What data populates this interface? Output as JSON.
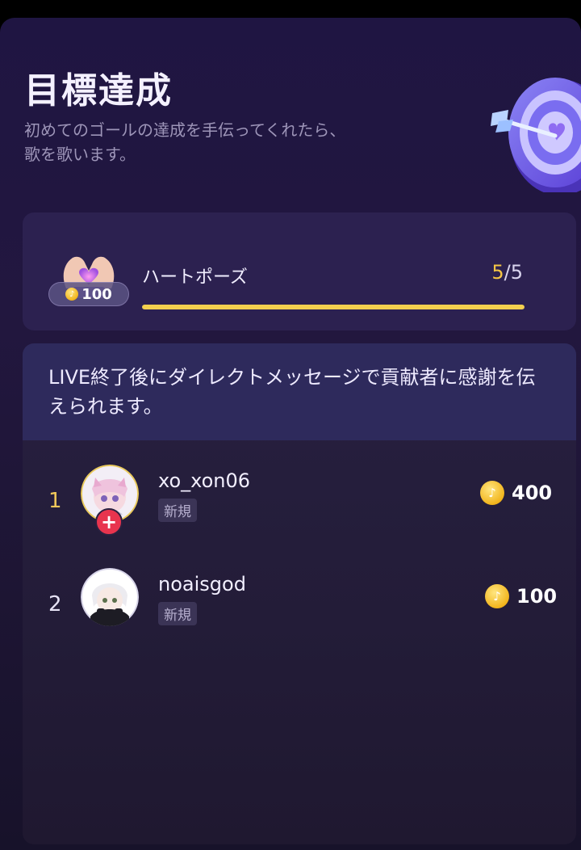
{
  "panel": {
    "title": "目標達成",
    "subtitle": "初めてのゴールの達成を手伝ってくれたら、歌を歌います。"
  },
  "goal": {
    "gift_name": "ハートポーズ",
    "gift_price": "100",
    "current": "5",
    "separator": "/",
    "target": "5",
    "progress_fraction": 1.0
  },
  "contributors": {
    "note": "LIVE終了後にダイレクトメッセージで貢献者に感謝を伝えられます。",
    "rows": [
      {
        "rank": "1",
        "username": "xo_xon06",
        "tag": "新規",
        "coins": "400"
      },
      {
        "rank": "2",
        "username": "noaisgod",
        "tag": "新規",
        "coins": "100"
      }
    ]
  },
  "colors": {
    "accent_gold": "#f5c544",
    "progress_fill": "#f4d04e",
    "follow_badge": "#e8344e"
  },
  "icons": {
    "coin": "tiktok-coin-icon",
    "follow": "plus-icon",
    "header_art": "target-arrow-icon",
    "gift": "heart-hands-icon"
  }
}
